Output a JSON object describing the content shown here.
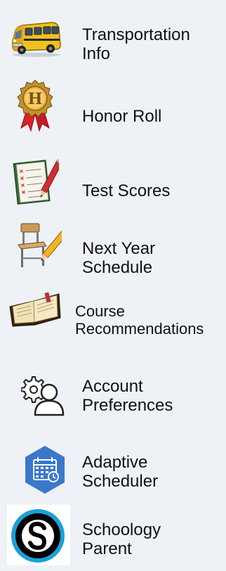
{
  "menu": {
    "items": [
      {
        "id": "transport",
        "label_line1": "Transportation",
        "label_line2": "Info",
        "icon": "school-bus-icon"
      },
      {
        "id": "honor",
        "label_line1": "Honor Roll",
        "label_line2": "",
        "icon": "honor-medal-icon"
      },
      {
        "id": "tests",
        "label_line1": "Test Scores",
        "label_line2": "",
        "icon": "test-sheet-pencil-icon"
      },
      {
        "id": "nextyear",
        "label_line1": "Next Year",
        "label_line2": "Schedule",
        "icon": "desk-pencil-icon"
      },
      {
        "id": "course",
        "label_line1": "Course",
        "label_line2": "Recommendations",
        "icon": "open-book-icon"
      },
      {
        "id": "account",
        "label_line1": "Account",
        "label_line2": "Preferences",
        "icon": "user-gear-icon"
      },
      {
        "id": "adaptive",
        "label_line1": "Adaptive",
        "label_line2": "Scheduler",
        "icon": "calendar-hexagon-icon"
      },
      {
        "id": "schoology",
        "label_line1": "Schoology",
        "label_line2": "Parent",
        "icon": "schoology-logo-icon"
      }
    ]
  },
  "colors": {
    "background": "#eef2f7",
    "text": "#111111",
    "bus_yellow": "#f2c21b",
    "adaptive_blue": "#3a78c9",
    "schoology_blue": "#1aa0d8"
  }
}
